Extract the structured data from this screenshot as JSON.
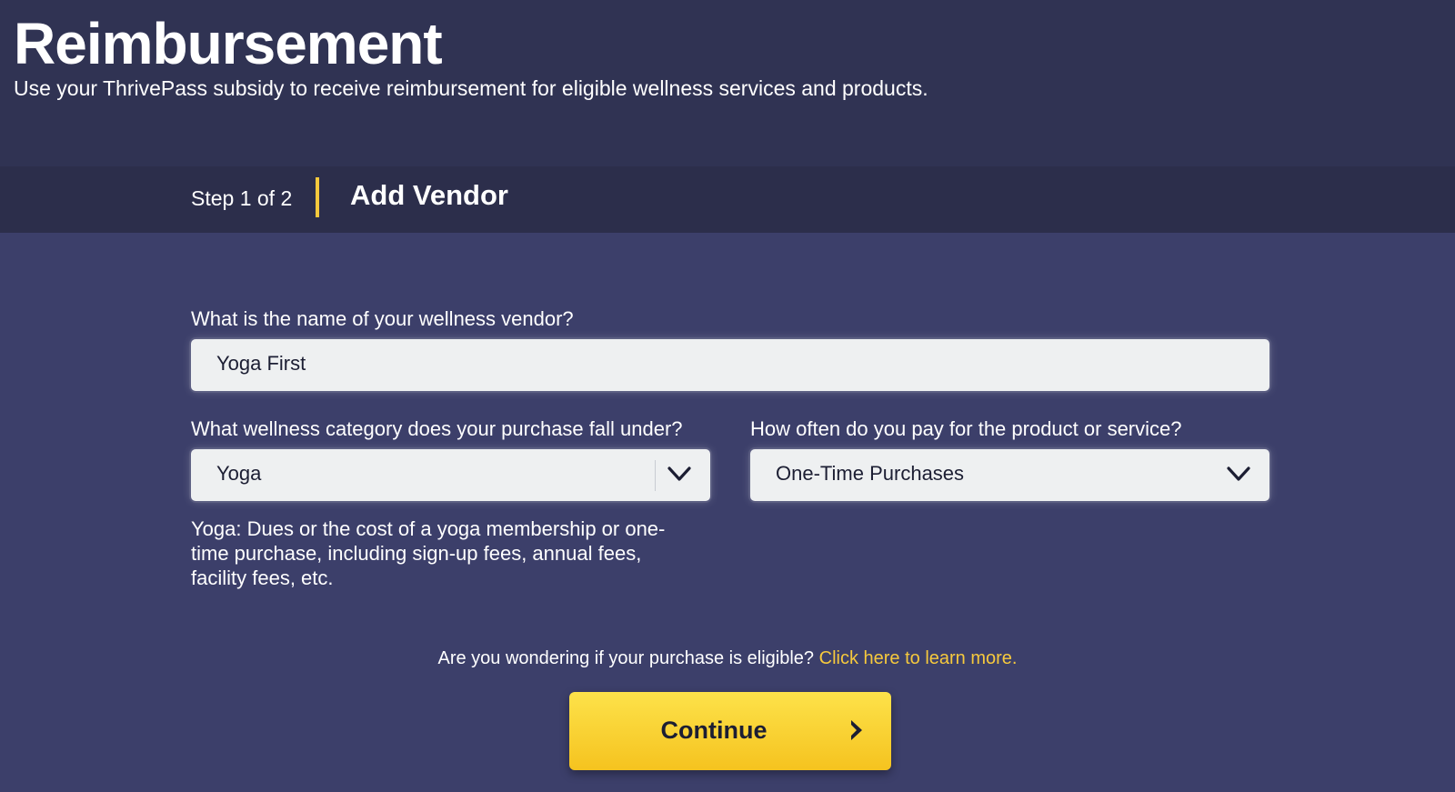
{
  "header": {
    "title": "Reimbursement",
    "subtitle": "Use your ThrivePass subsidy to receive reimbursement for eligible wellness services and products."
  },
  "stepbar": {
    "step_count": "Step 1 of 2",
    "step_title": "Add Vendor"
  },
  "form": {
    "vendor_label": "What is the name of your wellness vendor?",
    "vendor_value": "Yoga First",
    "category_label": "What wellness category does your purchase fall under?",
    "category_value": "Yoga",
    "frequency_label": "How often do you pay for the product or service?",
    "frequency_value": "One-Time Purchases",
    "category_help": "Yoga: Dues or the cost of a yoga membership or one-time purchase, including sign-up fees, annual fees, facility fees, etc."
  },
  "eligibility": {
    "question": "Are you wondering if your purchase is eligible?",
    "link": "Click here to learn more."
  },
  "actions": {
    "continue_label": "Continue"
  },
  "icons": {
    "dropdown": "chevron-down-icon",
    "continue": "chevron-right-icon"
  },
  "colors": {
    "header_bg": "#303353",
    "stepbar_bg": "#2c2e4b",
    "page_bg": "#3c3f6a",
    "accent": "#f6c93d",
    "field_bg": "#eef0f1"
  }
}
